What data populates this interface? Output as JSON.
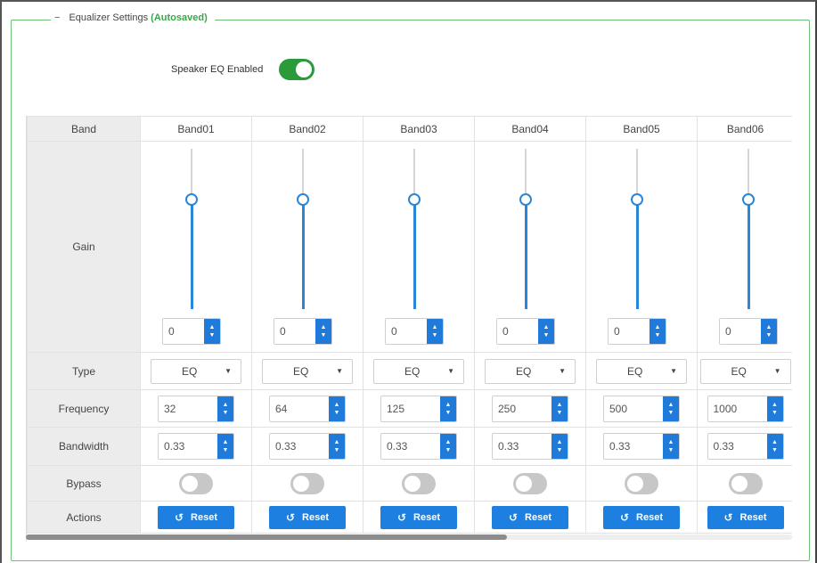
{
  "section": {
    "toggle_mark": "−",
    "title": "Equalizer Settings",
    "autosave": "(Autosaved)"
  },
  "speaker_eq": {
    "label": "Speaker EQ Enabled",
    "enabled": true
  },
  "rows": {
    "band": "Band",
    "gain": "Gain",
    "type": "Type",
    "frequency": "Frequency",
    "bandwidth": "Bandwidth",
    "bypass": "Bypass",
    "actions": "Actions"
  },
  "bands": [
    {
      "name": "Band01",
      "gain": "0",
      "type": "EQ",
      "frequency": "32",
      "bandwidth": "0.33",
      "bypass": false,
      "reset": "Reset"
    },
    {
      "name": "Band02",
      "gain": "0",
      "type": "EQ",
      "frequency": "64",
      "bandwidth": "0.33",
      "bypass": false,
      "reset": "Reset"
    },
    {
      "name": "Band03",
      "gain": "0",
      "type": "EQ",
      "frequency": "125",
      "bandwidth": "0.33",
      "bypass": false,
      "reset": "Reset"
    },
    {
      "name": "Band04",
      "gain": "0",
      "type": "EQ",
      "frequency": "250",
      "bandwidth": "0.33",
      "bypass": false,
      "reset": "Reset"
    },
    {
      "name": "Band05",
      "gain": "0",
      "type": "EQ",
      "frequency": "500",
      "bandwidth": "0.33",
      "bypass": false,
      "reset": "Reset"
    },
    {
      "name": "Band06",
      "gain": "0",
      "type": "EQ",
      "frequency": "1000",
      "bandwidth": "0.33",
      "bypass": false,
      "reset": "Reset"
    }
  ],
  "icons": {
    "spinner_up": "▲",
    "spinner_down": "▼",
    "caret": "▼",
    "reset": "↺"
  },
  "colors": {
    "accent": "#1d7fe0",
    "enabled_green": "#2b9a3a",
    "autosave_green": "#3aa64a",
    "switch_off": "#c7c7c7"
  }
}
